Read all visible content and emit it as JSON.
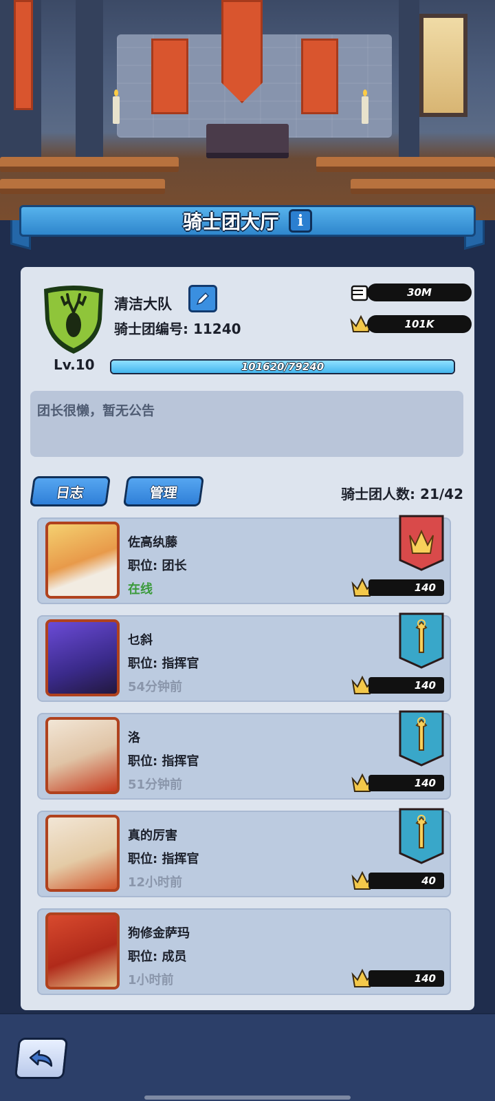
{
  "header": {
    "title": "骑士团大厅",
    "info_icon": "i"
  },
  "guild": {
    "name": "清洁大队",
    "id_label": "骑士团编号: 11240",
    "level": "Lv.10",
    "exp_text": "101620/79240",
    "exp_fraction": 1.0,
    "power": "30M",
    "crown_score": "101K",
    "emblem": "stag-shield-icon",
    "announcement": "团长很懒，暂无公告"
  },
  "tabs": {
    "log": "日志",
    "manage": "管理"
  },
  "member_count": "骑士团人数: 21/42",
  "members": [
    {
      "name": "佐高纨藤",
      "role": "职位: 团长",
      "status": "在线",
      "online": true,
      "score": "140",
      "rank_icon": "trident-crown-banner-icon",
      "rank_color": "#d94a4a"
    },
    {
      "name": "乜斜",
      "role": "职位: 指挥官",
      "status": "54分钟前",
      "online": false,
      "score": "140",
      "rank_icon": "sword-banner-icon",
      "rank_color": "#39a7c9"
    },
    {
      "name": "洛",
      "role": "职位: 指挥官",
      "status": "51分钟前",
      "online": false,
      "score": "140",
      "rank_icon": "sword-banner-icon",
      "rank_color": "#39a7c9"
    },
    {
      "name": "真的厉害",
      "role": "职位: 指挥官",
      "status": "12小时前",
      "online": false,
      "score": "40",
      "rank_icon": "sword-banner-icon",
      "rank_color": "#39a7c9"
    },
    {
      "name": "狗修金萨玛",
      "role": "职位: 成员",
      "status": "1小时前",
      "online": false,
      "score": "140",
      "rank_icon": "",
      "rank_color": ""
    }
  ],
  "colors": {
    "online": "#3a9a3a",
    "offline": "#8a96ab",
    "accent": "#2f86cc"
  }
}
